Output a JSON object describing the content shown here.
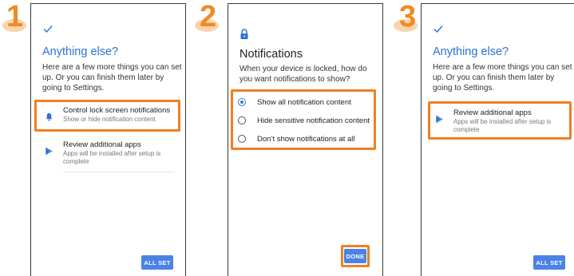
{
  "steps": [
    "1",
    "2",
    "3"
  ],
  "accent": "#2a72d6",
  "highlight_color": "#f07f22",
  "panel1": {
    "title": "Anything else?",
    "subtitle": "Here are a few more things you can set up. Or you can finish them later by going to Settings.",
    "items": [
      {
        "title": "Control lock screen notifications",
        "desc": "Show or hide notification content",
        "icon": "bell-icon"
      },
      {
        "title": "Review additional apps",
        "desc": "Apps will be installed after setup is complete",
        "icon": "play-store-icon"
      }
    ],
    "button": "ALL SET"
  },
  "panel2": {
    "title": "Notifications",
    "subtitle": "When your device is locked, how do you want notifications to show?",
    "options": [
      {
        "label": "Show all notification content",
        "selected": true
      },
      {
        "label": "Hide sensitive notification content",
        "selected": false
      },
      {
        "label": "Don’t show notifications at all",
        "selected": false
      }
    ],
    "button": "DONE"
  },
  "panel3": {
    "title": "Anything else?",
    "subtitle": "Here are a few more things you can set up. Or you can finish them later by going to Settings.",
    "items": [
      {
        "title": "Review additional apps",
        "desc": "Apps will be installed after setup is complete",
        "icon": "play-store-icon"
      }
    ],
    "button": "ALL SET"
  }
}
